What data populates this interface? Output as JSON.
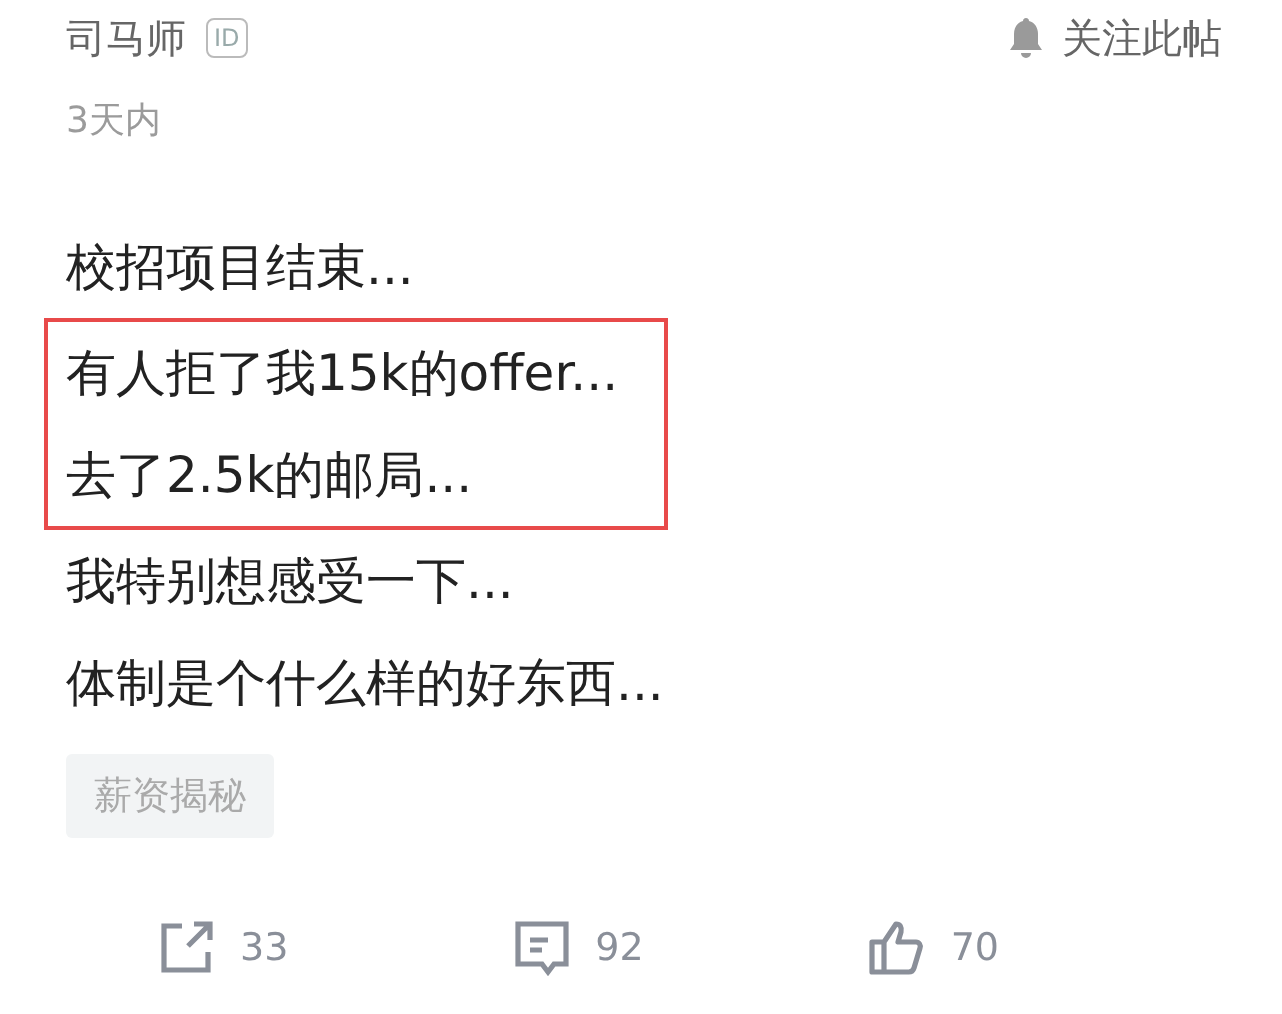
{
  "author": {
    "name": "司马师",
    "badge": "ID"
  },
  "follow": {
    "label": "关注此帖"
  },
  "time": "3天内",
  "lines": [
    {
      "text": "校招项目结束...",
      "boxed": false
    },
    {
      "text": "有人拒了我15k的offer...",
      "boxed": true
    },
    {
      "text": "去了2.5k的邮局...",
      "boxed": true
    },
    {
      "text": "我特别想感受一下...",
      "boxed": false
    },
    {
      "text": "体制是个什么样的好东西...",
      "boxed": false
    }
  ],
  "tag": "薪资揭秘",
  "actions": [
    {
      "kind": "share",
      "count": "33"
    },
    {
      "kind": "comment",
      "count": "92"
    },
    {
      "kind": "like",
      "count": "70"
    }
  ]
}
